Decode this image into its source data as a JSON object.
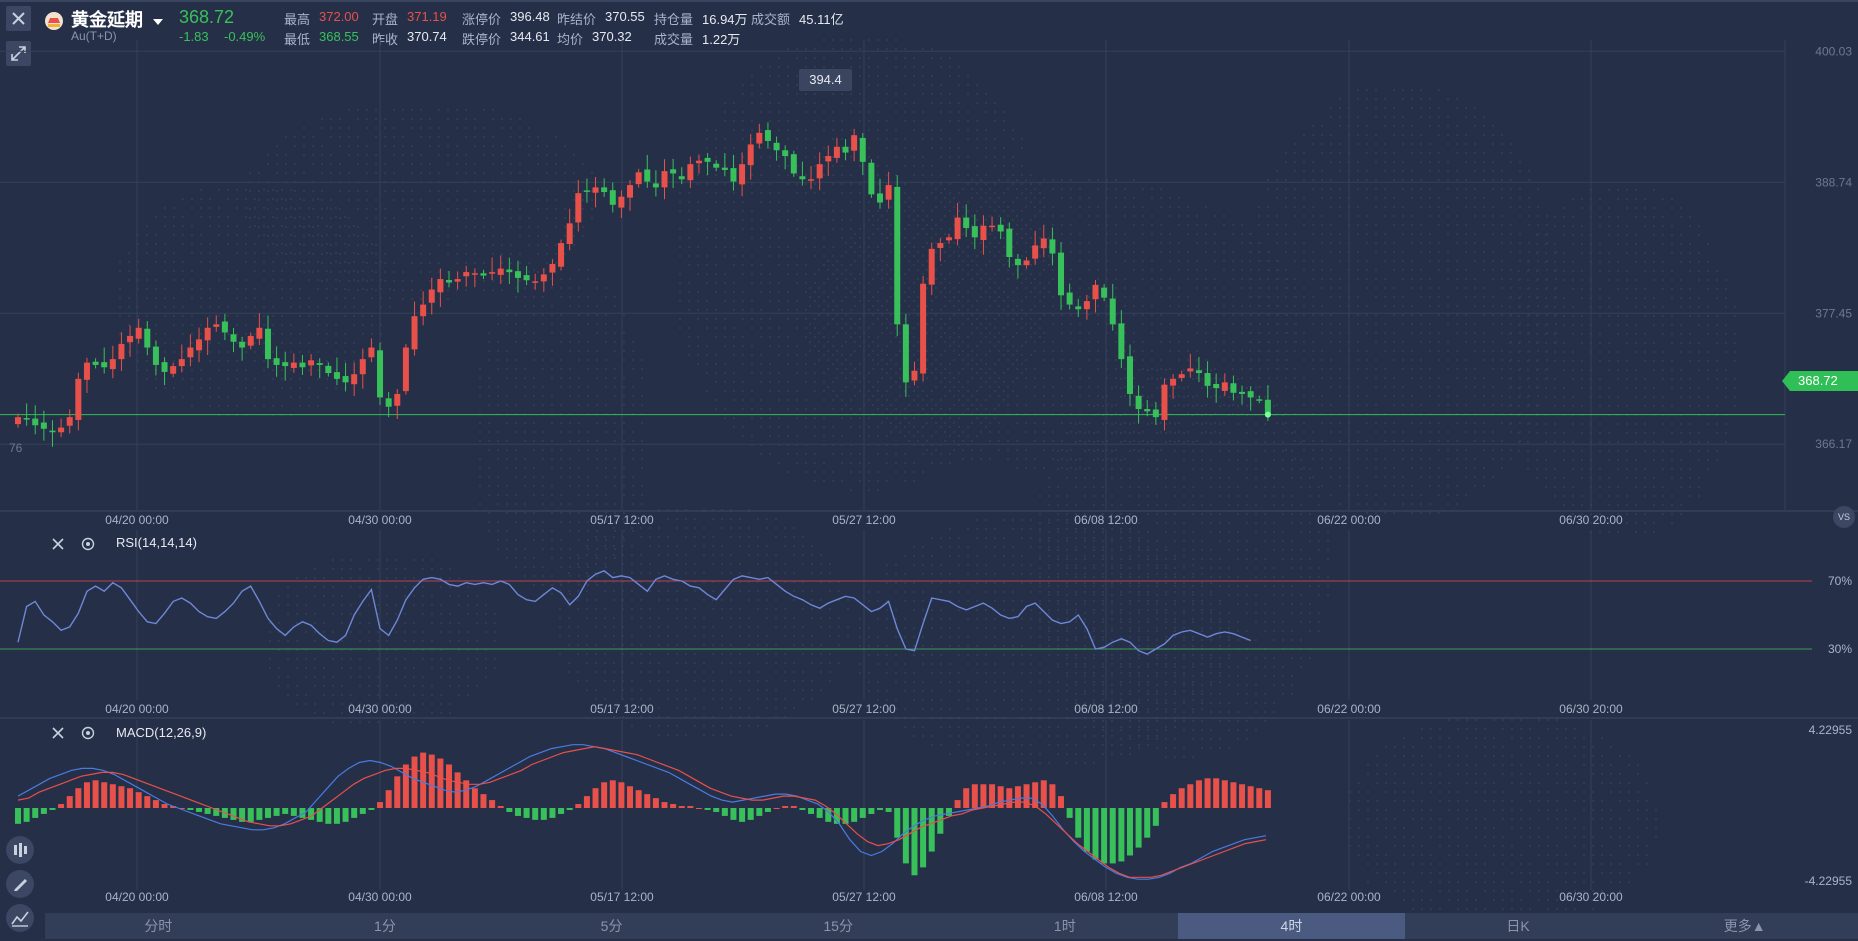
{
  "header": {
    "name": "黄金延期",
    "code": "Au(T+D)",
    "price": "368.72",
    "change": "-1.83",
    "change_pct": "-0.49%",
    "stats_row1": [
      {
        "label": "最高",
        "value": "372.00",
        "color": "red"
      },
      {
        "label": "开盘",
        "value": "371.19",
        "color": "red"
      },
      {
        "label": "涨停价",
        "value": "396.48",
        "color": "white"
      },
      {
        "label": "昨结价",
        "value": "370.55",
        "color": "white"
      },
      {
        "label": "持仓量",
        "value": "16.94万",
        "color": "white"
      },
      {
        "label": "成交额",
        "value": "45.11亿",
        "color": "white"
      }
    ],
    "stats_row2": [
      {
        "label": "最低",
        "value": "368.55",
        "color": "green"
      },
      {
        "label": "昨收",
        "value": "370.74",
        "color": "white"
      },
      {
        "label": "跌停价",
        "value": "344.61",
        "color": "white"
      },
      {
        "label": "均价",
        "value": "370.32",
        "color": "white"
      },
      {
        "label": "成交量",
        "value": "1.22万",
        "color": "white"
      }
    ]
  },
  "main_chart": {
    "y_ticks": [
      "400.03",
      "388.74",
      "377.45",
      "366.17"
    ],
    "current_price_tag": "368.72",
    "high_tag": "394.4",
    "left_edge_label": "76",
    "x_ticks": [
      "04/20 00:00",
      "04/30 00:00",
      "05/17 12:00",
      "05/27 12:00",
      "06/08 12:00",
      "06/22 00:00",
      "06/30 20:00"
    ],
    "vs_label": "VS"
  },
  "rsi": {
    "title": "RSI(14,14,14)",
    "levels": [
      "70%",
      "30%"
    ]
  },
  "macd": {
    "title": "MACD(12,26,9)",
    "y_top": "4.22955",
    "y_bottom": "-4.22955"
  },
  "timeframes": [
    "分时",
    "1分",
    "5分",
    "15分",
    "1时",
    "4时",
    "日K",
    "更多▲"
  ],
  "active_timeframe": "4时",
  "colors": {
    "up": "#e8504a",
    "down": "#38c15a",
    "bg": "#252f48",
    "rsi_line": "#6f87d6",
    "dif": "#4a7be0",
    "dea": "#e8504a"
  },
  "chart_data": [
    {
      "type": "candlestick",
      "title": "黄金延期 Au(T+D)",
      "ylim": [
        360.5,
        401
      ],
      "y_ticks": [
        400.03,
        388.74,
        377.45,
        366.17
      ],
      "x_ticks": [
        "04/20 00:00",
        "04/30 00:00",
        "05/17 12:00",
        "05/27 12:00",
        "06/08 12:00",
        "06/22 00:00",
        "06/30 20:00"
      ],
      "candle_count": 144,
      "last_close": 368.72,
      "annotated_high": 394.4,
      "grid": true,
      "close": [
        368.5,
        368.3,
        367.8,
        367.5,
        367.2,
        367.6,
        368.5,
        371.8,
        373.2,
        373.0,
        372.8,
        373.5,
        374.8,
        375.5,
        376.2,
        374.5,
        373.0,
        372.4,
        372.9,
        373.5,
        374.5,
        375.2,
        376.2,
        376.5,
        375.8,
        375.0,
        374.5,
        375.5,
        376.2,
        373.5,
        373.0,
        372.9,
        373.2,
        372.8,
        373.4,
        373.0,
        372.3,
        371.8,
        371.5,
        372.2,
        373.5,
        374.5,
        370.2,
        369.4,
        370.5,
        374.5,
        377.2,
        378.2,
        379.5,
        380.4,
        380.1,
        380.4,
        381.0,
        380.9,
        380.7,
        381.0,
        381.3,
        381.0,
        380.5,
        380.3,
        380.2,
        380.8,
        381.7,
        383.5,
        385.2,
        387.8,
        388.0,
        388.3,
        387.9,
        386.8,
        387.5,
        388.5,
        389.6,
        388.8,
        388.3,
        389.7,
        389.5,
        389.0,
        390.3,
        390.6,
        390.5,
        390.0,
        389.8,
        388.8,
        390.3,
        392.0,
        393.0,
        392.3,
        391.5,
        391.0,
        389.5,
        389.0,
        389.0,
        390.3,
        391.0,
        391.8,
        391.3,
        392.8,
        390.5,
        387.7,
        387.0,
        388.5,
        376.5,
        371.5,
        372.5,
        380.0,
        383.0,
        383.5,
        384.0,
        385.7,
        384.8,
        384.0,
        385.0,
        385.0,
        384.5,
        382.3,
        381.6,
        382.0,
        383.3,
        383.9,
        382.6,
        379.0,
        378.2,
        377.8,
        378.5,
        379.9,
        378.8,
        376.5,
        373.5,
        370.5,
        369.2,
        369.0,
        368.5,
        371.3,
        371.8,
        372.2,
        372.7,
        372.3,
        371.2,
        371.0,
        371.5,
        370.6,
        370.5,
        370.2,
        370.0,
        368.72
      ]
    },
    {
      "type": "line",
      "title": "RSI(14,14,14)",
      "ylim": [
        0,
        100
      ],
      "levels": [
        70,
        30
      ],
      "series": [
        {
          "values": [
            34,
            55,
            58,
            50,
            46,
            41,
            43,
            51,
            64,
            67,
            64,
            69,
            66,
            59,
            52,
            46,
            45,
            51,
            58,
            60,
            57,
            52,
            49,
            48,
            52,
            57,
            64,
            67,
            58,
            48,
            42,
            38,
            43,
            46,
            44,
            39,
            35,
            34,
            38,
            50,
            58,
            65,
            42,
            38,
            47,
            59,
            66,
            71,
            72,
            71,
            68,
            67,
            69,
            68,
            69,
            68,
            70,
            68,
            62,
            59,
            58,
            62,
            66,
            63,
            56,
            61,
            70,
            74,
            76,
            72,
            73,
            72,
            68,
            64,
            71,
            73,
            71,
            70,
            67,
            66,
            62,
            59,
            65,
            71,
            73,
            72,
            71,
            72,
            68,
            64,
            61,
            59,
            56,
            54,
            57,
            59,
            61,
            60,
            56,
            52,
            54,
            58,
            42,
            30,
            29,
            45,
            60,
            59,
            58,
            55,
            53,
            55,
            57,
            54,
            50,
            48,
            49,
            55,
            57,
            52,
            47,
            45,
            46,
            50,
            42,
            30,
            31,
            34,
            36,
            34,
            29,
            27,
            30,
            33,
            38,
            40,
            41,
            39,
            37,
            39,
            40,
            39,
            37,
            35
          ]
        }
      ]
    },
    {
      "type": "bar",
      "title": "MACD(12,26,9)",
      "ylim": [
        -4.22955,
        4.22955
      ],
      "series": [
        {
          "name": "MACD",
          "values": [
            -0.8,
            -0.7,
            -0.5,
            -0.3,
            -0.1,
            0.2,
            0.6,
            1.0,
            1.3,
            1.4,
            1.3,
            1.2,
            1.1,
            1.0,
            0.8,
            0.6,
            0.4,
            0.2,
            0.1,
            0.0,
            -0.1,
            -0.2,
            -0.3,
            -0.4,
            -0.5,
            -0.6,
            -0.7,
            -0.7,
            -0.6,
            -0.5,
            -0.4,
            -0.3,
            -0.4,
            -0.5,
            -0.6,
            -0.7,
            -0.8,
            -0.8,
            -0.7,
            -0.5,
            -0.3,
            -0.1,
            0.3,
            0.9,
            1.6,
            2.2,
            2.6,
            2.8,
            2.7,
            2.5,
            2.2,
            1.8,
            1.4,
            1.0,
            0.7,
            0.4,
            0.1,
            -0.2,
            -0.4,
            -0.5,
            -0.6,
            -0.6,
            -0.5,
            -0.3,
            -0.1,
            0.2,
            0.6,
            1.0,
            1.3,
            1.4,
            1.3,
            1.1,
            0.9,
            0.7,
            0.5,
            0.3,
            0.2,
            0.1,
            0.1,
            0.0,
            -0.1,
            -0.2,
            -0.4,
            -0.6,
            -0.7,
            -0.6,
            -0.4,
            -0.2,
            0.0,
            0.1,
            0.1,
            -0.1,
            -0.3,
            -0.5,
            -0.7,
            -0.8,
            -0.8,
            -0.7,
            -0.5,
            -0.3,
            -0.1,
            -0.2,
            -1.5,
            -2.8,
            -3.4,
            -3.0,
            -2.2,
            -1.3,
            -0.4,
            0.4,
            1.0,
            1.2,
            1.2,
            1.2,
            1.1,
            1.0,
            1.1,
            1.2,
            1.3,
            1.4,
            1.2,
            0.6,
            -0.5,
            -1.5,
            -2.2,
            -2.6,
            -2.8,
            -2.8,
            -2.7,
            -2.4,
            -2.0,
            -1.5,
            -0.9,
            0.3,
            0.7,
            1.0,
            1.2,
            1.4,
            1.5,
            1.5,
            1.4,
            1.3,
            1.2,
            1.1,
            1.0,
            0.9
          ]
        },
        {
          "name": "DIF",
          "values": [
            0.6,
            0.9,
            1.2,
            1.5,
            1.7,
            1.9,
            2.0,
            2.0,
            1.9,
            1.7,
            1.4,
            1.1,
            0.8,
            0.5,
            0.2,
            0.0,
            -0.2,
            -0.4,
            -0.6,
            -0.8,
            -0.9,
            -1.0,
            -1.1,
            -1.1,
            -1.0,
            -0.8,
            -0.5,
            -0.2,
            0.4,
            1.0,
            1.6,
            2.0,
            2.3,
            2.4,
            2.3,
            2.1,
            1.8,
            1.5,
            1.3,
            1.1,
            0.9,
            0.8,
            0.9,
            1.1,
            1.4,
            1.7,
            2.0,
            2.3,
            2.6,
            2.8,
            3.0,
            3.1,
            3.2,
            3.2,
            3.1,
            3.0,
            2.8,
            2.6,
            2.4,
            2.2,
            2.0,
            1.8,
            1.5,
            1.2,
            0.9,
            0.6,
            0.4,
            0.3,
            0.4,
            0.5,
            0.6,
            0.7,
            0.7,
            0.6,
            0.4,
            0.2,
            -0.2,
            -0.8,
            -1.6,
            -2.2,
            -2.4,
            -2.2,
            -1.8,
            -1.3,
            -0.9,
            -0.6,
            -0.4,
            -0.3,
            -0.2,
            -0.1,
            0.0,
            0.1,
            0.3,
            0.4,
            0.5,
            0.5,
            0.2,
            -0.4,
            -1.1,
            -1.7,
            -2.2,
            -2.6,
            -3.0,
            -3.3,
            -3.5,
            -3.6,
            -3.6,
            -3.5,
            -3.3,
            -3.0,
            -2.8,
            -2.5,
            -2.2,
            -2.0,
            -1.8,
            -1.6,
            -1.5,
            -1.4
          ]
        },
        {
          "name": "DEA",
          "values": [
            0.4,
            0.5,
            0.8,
            1.0,
            1.2,
            1.4,
            1.6,
            1.7,
            1.8,
            1.8,
            1.7,
            1.5,
            1.3,
            1.1,
            0.9,
            0.7,
            0.5,
            0.3,
            0.1,
            -0.1,
            -0.3,
            -0.5,
            -0.7,
            -0.8,
            -0.9,
            -0.9,
            -0.8,
            -0.6,
            -0.4,
            0.0,
            0.4,
            0.8,
            1.2,
            1.5,
            1.7,
            1.9,
            2.0,
            2.0,
            1.9,
            1.8,
            1.6,
            1.4,
            1.3,
            1.2,
            1.2,
            1.3,
            1.5,
            1.7,
            1.9,
            2.2,
            2.4,
            2.6,
            2.8,
            2.9,
            3.0,
            3.1,
            3.0,
            2.9,
            2.8,
            2.7,
            2.5,
            2.3,
            2.1,
            1.9,
            1.6,
            1.3,
            1.0,
            0.8,
            0.6,
            0.5,
            0.4,
            0.4,
            0.5,
            0.6,
            0.6,
            0.5,
            0.4,
            0.1,
            -0.3,
            -0.8,
            -1.3,
            -1.7,
            -1.9,
            -1.8,
            -1.6,
            -1.3,
            -1.0,
            -0.8,
            -0.6,
            -0.4,
            -0.3,
            -0.1,
            0.0,
            0.1,
            0.2,
            0.3,
            0.3,
            0.1,
            -0.3,
            -0.8,
            -1.3,
            -1.8,
            -2.2,
            -2.6,
            -3.0,
            -3.3,
            -3.5,
            -3.5,
            -3.5,
            -3.4,
            -3.2,
            -3.0,
            -2.8,
            -2.6,
            -2.4,
            -2.2,
            -2.0,
            -1.8,
            -1.7,
            -1.6
          ]
        }
      ]
    }
  ]
}
